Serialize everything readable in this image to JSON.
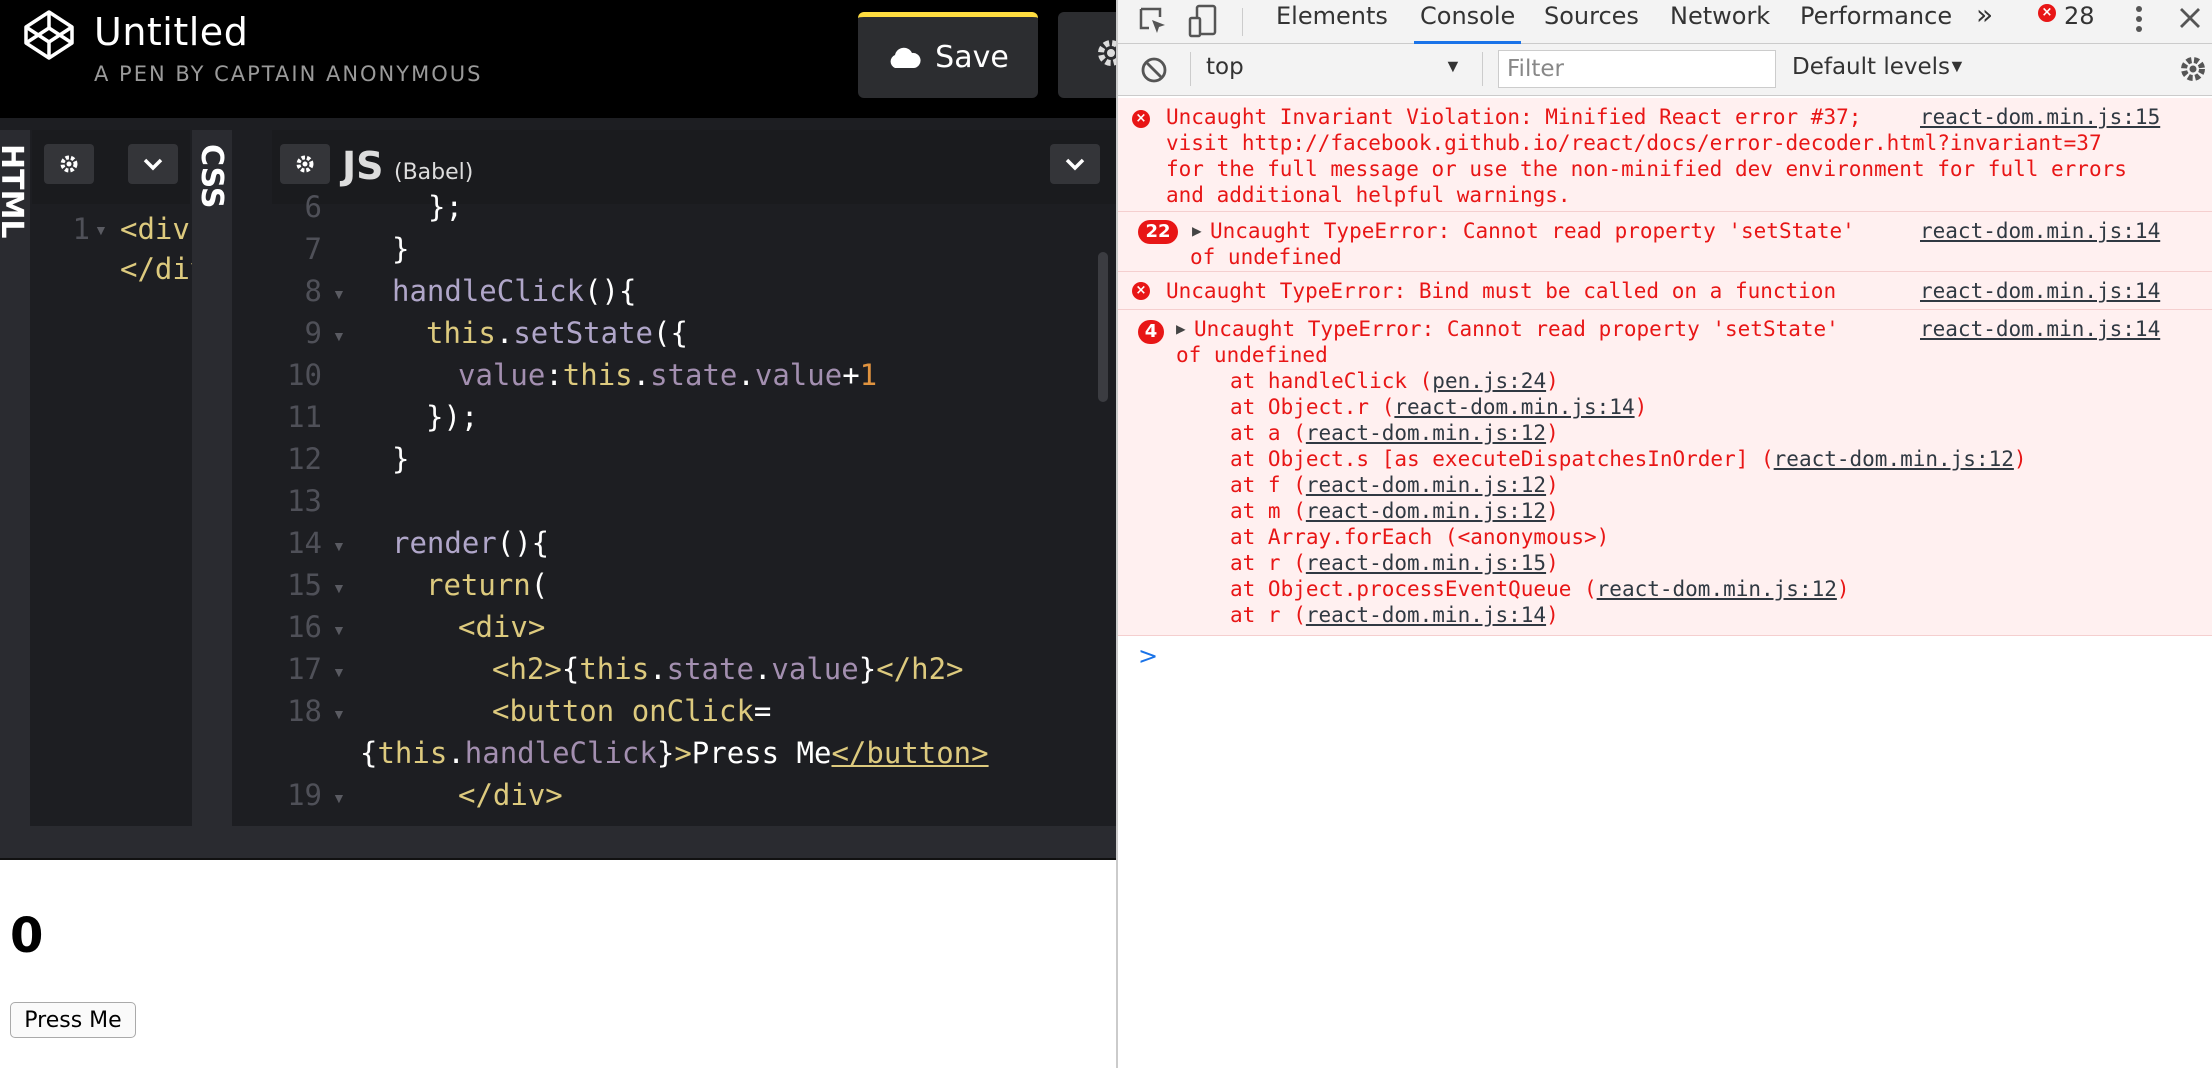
{
  "pen": {
    "title": "Untitled",
    "subtitle": "A PEN BY CAPTAIN ANONYMOUS",
    "save_label": "Save",
    "editors": {
      "html_label": "HTML",
      "css_label": "CSS",
      "js_label": "JS",
      "js_sublabel": "(Babel)",
      "html_lines": [
        {
          "num": "1",
          "text": "<div"
        },
        {
          "num": "",
          "text": "</div"
        }
      ],
      "js_line_numbers": [
        "6",
        "7",
        "8",
        "9",
        "10",
        "11",
        "12",
        "13",
        "14",
        "15",
        "16",
        "17",
        "18",
        "",
        "19"
      ]
    },
    "preview": {
      "value": "0",
      "button_label": "Press Me"
    }
  },
  "devtools": {
    "tabs": [
      "Elements",
      "Console",
      "Sources",
      "Network",
      "Performance"
    ],
    "more_tabs": "»",
    "error_count": "28",
    "context": "top",
    "filter_placeholder": "Filter",
    "levels": "Default levels",
    "messages": [
      {
        "lines": [
          "Uncaught Invariant Violation: Minified React error #37;",
          "visit http://facebook.github.io/react/docs/error-decoder.html?invariant=37",
          "for the full message or use the non-minified dev environment for full errors",
          "and additional helpful warnings."
        ],
        "source": "react-dom.min.js:15"
      },
      {
        "count": "22",
        "lines": [
          "Uncaught TypeError: Cannot read property 'setState'",
          "of undefined"
        ],
        "source": "react-dom.min.js:14"
      },
      {
        "lines": [
          "Uncaught TypeError: Bind must be called on a function"
        ],
        "source": "react-dom.min.js:14"
      },
      {
        "count": "4",
        "lines": [
          "Uncaught TypeError: Cannot read property 'setState'",
          "of undefined"
        ],
        "source": "react-dom.min.js:14",
        "stack": [
          {
            "pre": "at handleClick (",
            "link": "pen.js:24",
            "post": ")"
          },
          {
            "pre": "at Object.r (",
            "link": "react-dom.min.js:14",
            "post": ")"
          },
          {
            "pre": "at a (",
            "link": "react-dom.min.js:12",
            "post": ")"
          },
          {
            "pre": "at Object.s [as executeDispatchesInOrder] (",
            "link": "react-dom.min.js:12",
            "post": ")"
          },
          {
            "pre": "at f (",
            "link": "react-dom.min.js:12",
            "post": ")"
          },
          {
            "pre": "at m (",
            "link": "react-dom.min.js:12",
            "post": ")"
          },
          {
            "pre": "at Array.forEach (<anonymous>)",
            "link": "",
            "post": ""
          },
          {
            "pre": "at r (",
            "link": "react-dom.min.js:15",
            "post": ")"
          },
          {
            "pre": "at Object.processEventQueue (",
            "link": "react-dom.min.js:12",
            "post": ")"
          },
          {
            "pre": "at r (",
            "link": "react-dom.min.js:14",
            "post": ")"
          }
        ]
      }
    ],
    "prompt": ">"
  },
  "colors": {
    "accent": "#1a73e8",
    "error": "#e81616",
    "save_border": "#ffdd40"
  }
}
